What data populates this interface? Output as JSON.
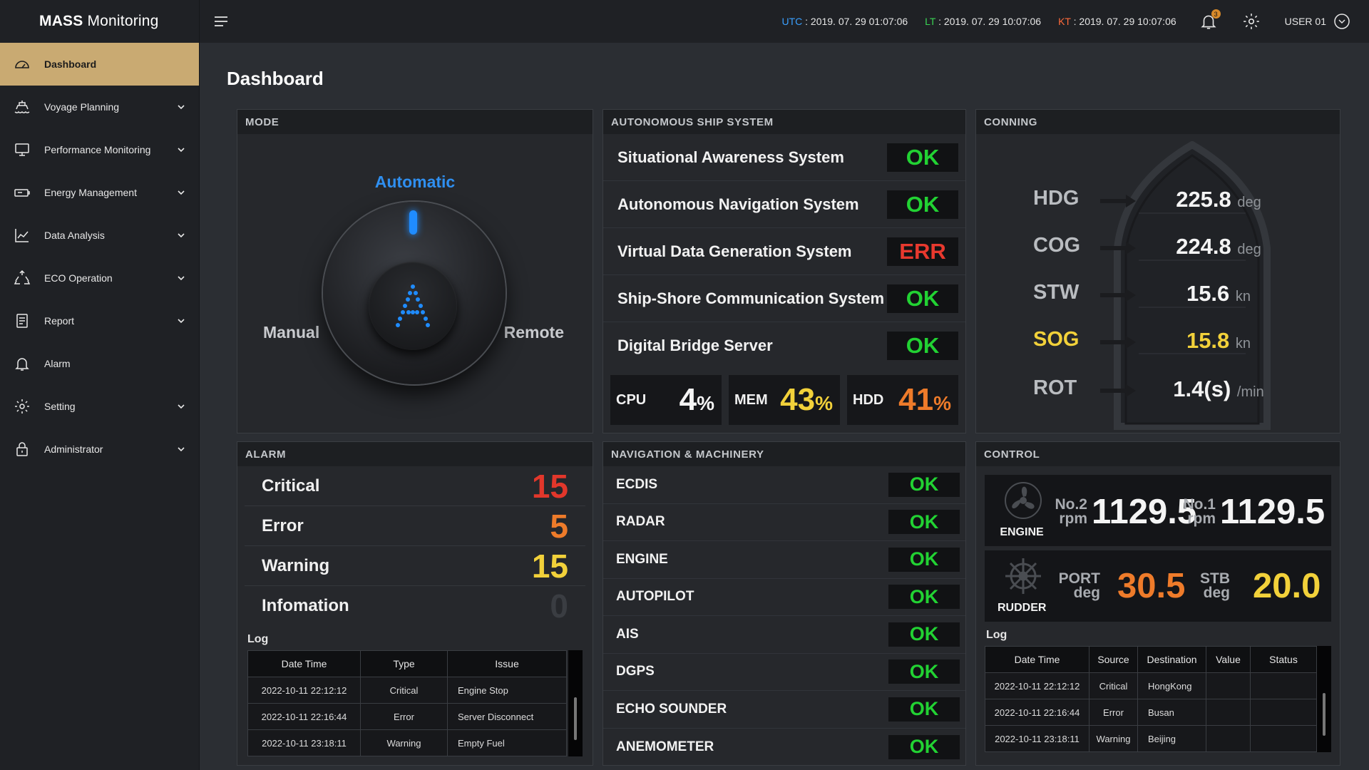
{
  "app": {
    "title_bold": "MASS",
    "title_rest": "Monitoring"
  },
  "sidebar": {
    "items": [
      {
        "label": "Dashboard",
        "icon": "gauge-icon"
      },
      {
        "label": "Voyage Planning",
        "icon": "ship-icon"
      },
      {
        "label": "Performance Monitoring",
        "icon": "monitor-icon"
      },
      {
        "label": "Energy Management",
        "icon": "battery-icon"
      },
      {
        "label": "Data Analysis",
        "icon": "chart-icon"
      },
      {
        "label": "ECO Operation",
        "icon": "recycle-icon"
      },
      {
        "label": "Report",
        "icon": "document-icon"
      },
      {
        "label": "Alarm",
        "icon": "bell-icon"
      },
      {
        "label": "Setting",
        "icon": "gear-icon"
      },
      {
        "label": "Administrator",
        "icon": "lock-icon"
      }
    ]
  },
  "topbar": {
    "utc_label": "UTC",
    "utc_value": ": 2019. 07. 29  01:07:06",
    "lt_label": "LT",
    "lt_value": ": 2019. 07. 29  10:07:06",
    "kt_label": "KT",
    "kt_value": ": 2019. 07. 29  10:07:06",
    "notification_count": "3",
    "user": "USER 01"
  },
  "page_title": "Dashboard",
  "mode": {
    "header": "MODE",
    "automatic": "Automatic",
    "manual": "Manual",
    "remote": "Remote",
    "accent": "#2f8ff0"
  },
  "ass": {
    "header": "AUTONOMOUS SHIP SYSTEM",
    "systems": [
      {
        "name": "Situational Awareness System",
        "status": "OK"
      },
      {
        "name": "Autonomous Navigation System",
        "status": "OK"
      },
      {
        "name": "Virtual Data Generation System",
        "status": "ERR"
      },
      {
        "name": "Ship-Shore Communication System",
        "status": "OK"
      },
      {
        "name": "Digital Bridge Server",
        "status": "OK"
      }
    ],
    "cpu_label": "CPU",
    "cpu_value": "4",
    "cpu_unit": "%",
    "mem_label": "MEM",
    "mem_value": "43",
    "mem_unit": "%",
    "hdd_label": "HDD",
    "hdd_value": "41",
    "hdd_unit": "%"
  },
  "conning": {
    "header": "CONNING",
    "rows": [
      {
        "label": "HDG",
        "value": "225.8",
        "unit": "deg"
      },
      {
        "label": "COG",
        "value": "224.8",
        "unit": "deg"
      },
      {
        "label": "STW",
        "value": "15.6",
        "unit": "kn"
      },
      {
        "label": "SOG",
        "value": "15.8",
        "unit": "kn"
      },
      {
        "label": "ROT",
        "value": "1.4(s)",
        "unit": "/min"
      }
    ]
  },
  "alarm": {
    "header": "ALARM",
    "rows": [
      {
        "label": "Critical",
        "count": "15",
        "color": "#e2372b"
      },
      {
        "label": "Error",
        "count": "5",
        "color": "#ee7b2a"
      },
      {
        "label": "Warning",
        "count": "15",
        "color": "#f2d13a"
      },
      {
        "label": "Infomation",
        "count": "0",
        "color": "#3a3d42"
      }
    ],
    "log_title": "Log",
    "log_columns": [
      "Date Time",
      "Type",
      "Issue"
    ],
    "log_rows": [
      [
        "2022-10-11 22:12:12",
        "Critical",
        "Engine Stop"
      ],
      [
        "2022-10-11 22:16:44",
        "Error",
        "Server Disconnect"
      ],
      [
        "2022-10-11 23:18:11",
        "Warning",
        "Empty Fuel"
      ]
    ]
  },
  "nav_machinery": {
    "header": "NAVIGATION & MACHINERY",
    "items": [
      {
        "name": "ECDIS",
        "status": "OK"
      },
      {
        "name": "RADAR",
        "status": "OK"
      },
      {
        "name": "ENGINE",
        "status": "OK"
      },
      {
        "name": "AUTOPILOT",
        "status": "OK"
      },
      {
        "name": "AIS",
        "status": "OK"
      },
      {
        "name": "DGPS",
        "status": "OK"
      },
      {
        "name": "ECHO SOUNDER",
        "status": "OK"
      },
      {
        "name": "ANEMOMETER",
        "status": "OK"
      }
    ]
  },
  "control": {
    "header": "CONTROL",
    "engine_label": "ENGINE",
    "no2_label": "No.2",
    "no2_unit": "rpm",
    "no2_value": "1129.5",
    "no1_label": "No.1",
    "no1_unit": "rpm",
    "no1_value": "1129.5",
    "rudder_label": "RUDDER",
    "port_label": "PORT",
    "port_unit": "deg",
    "port_value": "30.5",
    "stb_label": "STB",
    "stb_unit": "deg",
    "stb_value": "20.0",
    "log_title": "Log",
    "log_columns": [
      "Date Time",
      "Source",
      "Destination",
      "Value",
      "Status"
    ],
    "log_rows": [
      [
        "2022-10-11 22:12:12",
        "Critical",
        "HongKong",
        "",
        ""
      ],
      [
        "2022-10-11 22:16:44",
        "Error",
        "Busan",
        "",
        ""
      ],
      [
        "2022-10-11 23:18:11",
        "Warning",
        "Beijing",
        "",
        ""
      ]
    ]
  }
}
